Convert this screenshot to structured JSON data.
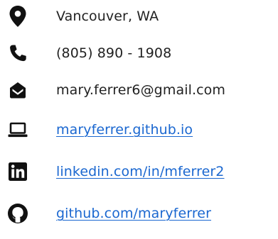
{
  "contact": {
    "location": {
      "icon": "map-marker-icon",
      "text": "Vancouver, WA"
    },
    "phone": {
      "icon": "phone-icon",
      "text": "(805) 890 - 1908"
    },
    "email": {
      "icon": "envelope-open-icon",
      "text": "mary.ferrer6@gmail.com"
    },
    "website": {
      "icon": "laptop-icon",
      "text": "maryferrer.github.io"
    },
    "linkedin": {
      "icon": "linkedin-icon",
      "text": "linkedin.com/in/mferrer2"
    },
    "github": {
      "icon": "github-icon",
      "text": "github.com/maryferrer"
    }
  },
  "colors": {
    "text": "#222222",
    "link": "#1a67d0",
    "icon": "#111111",
    "background": "#ffffff"
  }
}
